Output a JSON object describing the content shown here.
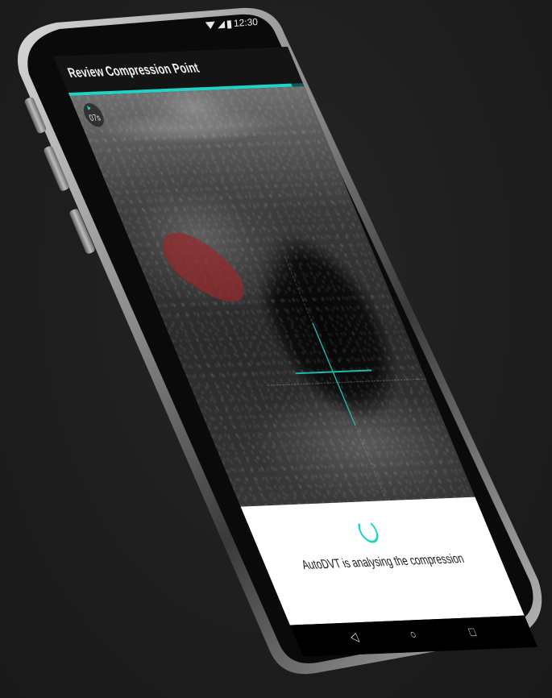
{
  "status_bar": {
    "time": "12:30",
    "icons": [
      "wifi-icon",
      "signal-icon",
      "battery-icon"
    ]
  },
  "app_bar": {
    "title": "Review Compression Point",
    "progress_fraction": 0.95
  },
  "scan": {
    "timer_icon": "play-icon",
    "timer_value": "07s"
  },
  "bottom_panel": {
    "spinner_icon": "loading-spinner-icon",
    "status_text": "AutoDVT is analysing the compression"
  },
  "nav_bar": {
    "back_icon": "back-icon",
    "home_icon": "home-icon",
    "recents_icon": "recents-icon"
  },
  "colors": {
    "accent": "#22d3c5",
    "vessel_overlay": "#962d2d",
    "background": "#1e1e1e"
  }
}
